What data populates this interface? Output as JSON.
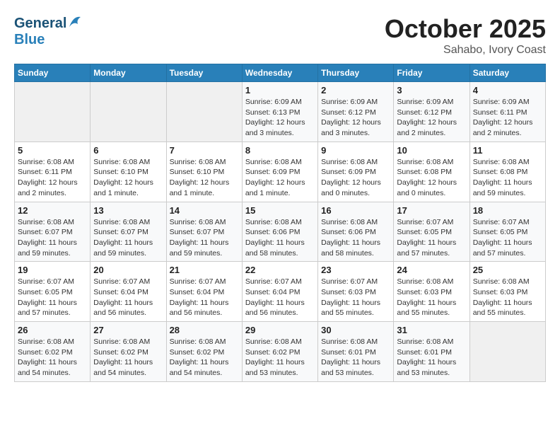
{
  "header": {
    "logo_general": "General",
    "logo_blue": "Blue",
    "month_title": "October 2025",
    "subtitle": "Sahabo, Ivory Coast"
  },
  "weekdays": [
    "Sunday",
    "Monday",
    "Tuesday",
    "Wednesday",
    "Thursday",
    "Friday",
    "Saturday"
  ],
  "weeks": [
    [
      {
        "day": "",
        "info": ""
      },
      {
        "day": "",
        "info": ""
      },
      {
        "day": "",
        "info": ""
      },
      {
        "day": "1",
        "info": "Sunrise: 6:09 AM\nSunset: 6:13 PM\nDaylight: 12 hours\nand 3 minutes."
      },
      {
        "day": "2",
        "info": "Sunrise: 6:09 AM\nSunset: 6:12 PM\nDaylight: 12 hours\nand 3 minutes."
      },
      {
        "day": "3",
        "info": "Sunrise: 6:09 AM\nSunset: 6:12 PM\nDaylight: 12 hours\nand 2 minutes."
      },
      {
        "day": "4",
        "info": "Sunrise: 6:09 AM\nSunset: 6:11 PM\nDaylight: 12 hours\nand 2 minutes."
      }
    ],
    [
      {
        "day": "5",
        "info": "Sunrise: 6:08 AM\nSunset: 6:11 PM\nDaylight: 12 hours\nand 2 minutes."
      },
      {
        "day": "6",
        "info": "Sunrise: 6:08 AM\nSunset: 6:10 PM\nDaylight: 12 hours\nand 1 minute."
      },
      {
        "day": "7",
        "info": "Sunrise: 6:08 AM\nSunset: 6:10 PM\nDaylight: 12 hours\nand 1 minute."
      },
      {
        "day": "8",
        "info": "Sunrise: 6:08 AM\nSunset: 6:09 PM\nDaylight: 12 hours\nand 1 minute."
      },
      {
        "day": "9",
        "info": "Sunrise: 6:08 AM\nSunset: 6:09 PM\nDaylight: 12 hours\nand 0 minutes."
      },
      {
        "day": "10",
        "info": "Sunrise: 6:08 AM\nSunset: 6:08 PM\nDaylight: 12 hours\nand 0 minutes."
      },
      {
        "day": "11",
        "info": "Sunrise: 6:08 AM\nSunset: 6:08 PM\nDaylight: 11 hours\nand 59 minutes."
      }
    ],
    [
      {
        "day": "12",
        "info": "Sunrise: 6:08 AM\nSunset: 6:07 PM\nDaylight: 11 hours\nand 59 minutes."
      },
      {
        "day": "13",
        "info": "Sunrise: 6:08 AM\nSunset: 6:07 PM\nDaylight: 11 hours\nand 59 minutes."
      },
      {
        "day": "14",
        "info": "Sunrise: 6:08 AM\nSunset: 6:07 PM\nDaylight: 11 hours\nand 59 minutes."
      },
      {
        "day": "15",
        "info": "Sunrise: 6:08 AM\nSunset: 6:06 PM\nDaylight: 11 hours\nand 58 minutes."
      },
      {
        "day": "16",
        "info": "Sunrise: 6:08 AM\nSunset: 6:06 PM\nDaylight: 11 hours\nand 58 minutes."
      },
      {
        "day": "17",
        "info": "Sunrise: 6:07 AM\nSunset: 6:05 PM\nDaylight: 11 hours\nand 57 minutes."
      },
      {
        "day": "18",
        "info": "Sunrise: 6:07 AM\nSunset: 6:05 PM\nDaylight: 11 hours\nand 57 minutes."
      }
    ],
    [
      {
        "day": "19",
        "info": "Sunrise: 6:07 AM\nSunset: 6:05 PM\nDaylight: 11 hours\nand 57 minutes."
      },
      {
        "day": "20",
        "info": "Sunrise: 6:07 AM\nSunset: 6:04 PM\nDaylight: 11 hours\nand 56 minutes."
      },
      {
        "day": "21",
        "info": "Sunrise: 6:07 AM\nSunset: 6:04 PM\nDaylight: 11 hours\nand 56 minutes."
      },
      {
        "day": "22",
        "info": "Sunrise: 6:07 AM\nSunset: 6:04 PM\nDaylight: 11 hours\nand 56 minutes."
      },
      {
        "day": "23",
        "info": "Sunrise: 6:07 AM\nSunset: 6:03 PM\nDaylight: 11 hours\nand 55 minutes."
      },
      {
        "day": "24",
        "info": "Sunrise: 6:08 AM\nSunset: 6:03 PM\nDaylight: 11 hours\nand 55 minutes."
      },
      {
        "day": "25",
        "info": "Sunrise: 6:08 AM\nSunset: 6:03 PM\nDaylight: 11 hours\nand 55 minutes."
      }
    ],
    [
      {
        "day": "26",
        "info": "Sunrise: 6:08 AM\nSunset: 6:02 PM\nDaylight: 11 hours\nand 54 minutes."
      },
      {
        "day": "27",
        "info": "Sunrise: 6:08 AM\nSunset: 6:02 PM\nDaylight: 11 hours\nand 54 minutes."
      },
      {
        "day": "28",
        "info": "Sunrise: 6:08 AM\nSunset: 6:02 PM\nDaylight: 11 hours\nand 54 minutes."
      },
      {
        "day": "29",
        "info": "Sunrise: 6:08 AM\nSunset: 6:02 PM\nDaylight: 11 hours\nand 53 minutes."
      },
      {
        "day": "30",
        "info": "Sunrise: 6:08 AM\nSunset: 6:01 PM\nDaylight: 11 hours\nand 53 minutes."
      },
      {
        "day": "31",
        "info": "Sunrise: 6:08 AM\nSunset: 6:01 PM\nDaylight: 11 hours\nand 53 minutes."
      },
      {
        "day": "",
        "info": ""
      }
    ]
  ]
}
